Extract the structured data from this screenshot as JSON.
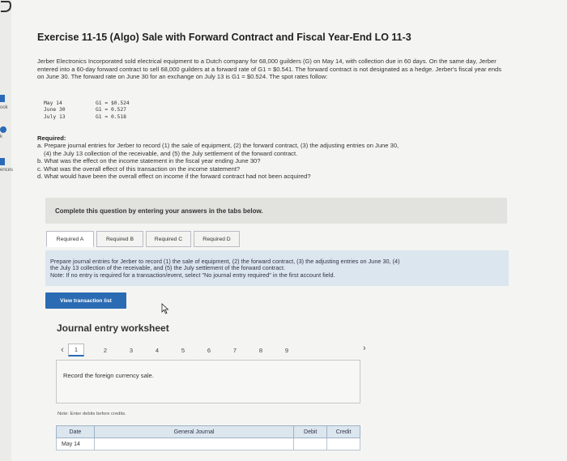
{
  "sidebar": {
    "labels": [
      "ook",
      "k",
      "ences"
    ]
  },
  "title": "Exercise 11-15 (Algo) Sale with Forward Contract and Fiscal Year-End LO 11-3",
  "problem_text": "Jerber Electronics Incorporated sold electrical equipment to a Dutch company for 68,000 guilders (G) on May 14, with collection due in 60 days. On the same day, Jerber entered into a 60-day forward contract to sell 68,000 guilders at a forward rate of G1 = $0.541. The forward contract is not designated as a hedge. Jerber's fiscal year ends on June 30. The forward rate on June 30 for an exchange on July 13 is G1 = $0.524. The spot rates follow:",
  "spot_rates": [
    {
      "date": "May 14",
      "rate": "G1 = $0.524"
    },
    {
      "date": "June 30",
      "rate": "G1 = 0.527"
    },
    {
      "date": "July 13",
      "rate": "G1 = 0.518"
    }
  ],
  "required": {
    "heading": "Required:",
    "a1": "a. Prepare journal entries for Jerber to record (1) the sale of equipment, (2) the forward contract, (3) the adjusting entries on June 30,",
    "a2": "(4) the July 13 collection of the receivable, and (5) the July settlement of the forward contract.",
    "b": "b. What was the effect on the income statement in the fiscal year ending June 30?",
    "c": "c. What was the overall effect of this transaction on the income statement?",
    "d": "d. What would have been the overall effect on income if the forward contract had not been acquired?"
  },
  "banner": "Complete this question by entering your answers in the tabs below.",
  "tabs": [
    "Required A",
    "Required B",
    "Required C",
    "Required D"
  ],
  "instructions": {
    "line1": "Prepare journal entries for Jerber to record (1) the sale of equipment, (2) the forward contract, (3) the adjusting entries on June 30, (4)",
    "line2": "the July 13 collection of the receivable, and (5) the July settlement of the forward contract.",
    "line3": "Note: If no entry is required for a transaction/event, select \"No journal entry required\" in the first account field."
  },
  "view_transaction_button": "View transaction list",
  "worksheet": {
    "title": "Journal entry worksheet",
    "pages": [
      "1",
      "2",
      "3",
      "4",
      "5",
      "6",
      "7",
      "8",
      "9"
    ],
    "active_page": "1",
    "prev_icon": "chevron-left-icon",
    "next_icon": "chevron-right-icon",
    "record_text": "Record the foreign currency sale.",
    "note": "Note: Enter debits before credits.",
    "columns": {
      "date": "Date",
      "general_journal": "General Journal",
      "debit": "Debit",
      "credit": "Credit"
    },
    "rows": [
      {
        "date": "May 14",
        "account": "",
        "debit": "",
        "credit": ""
      }
    ]
  },
  "colors": {
    "accent": "#2a6bb4",
    "instruction_bg": "#dbe6ef",
    "banner_bg": "#e2e3de"
  }
}
